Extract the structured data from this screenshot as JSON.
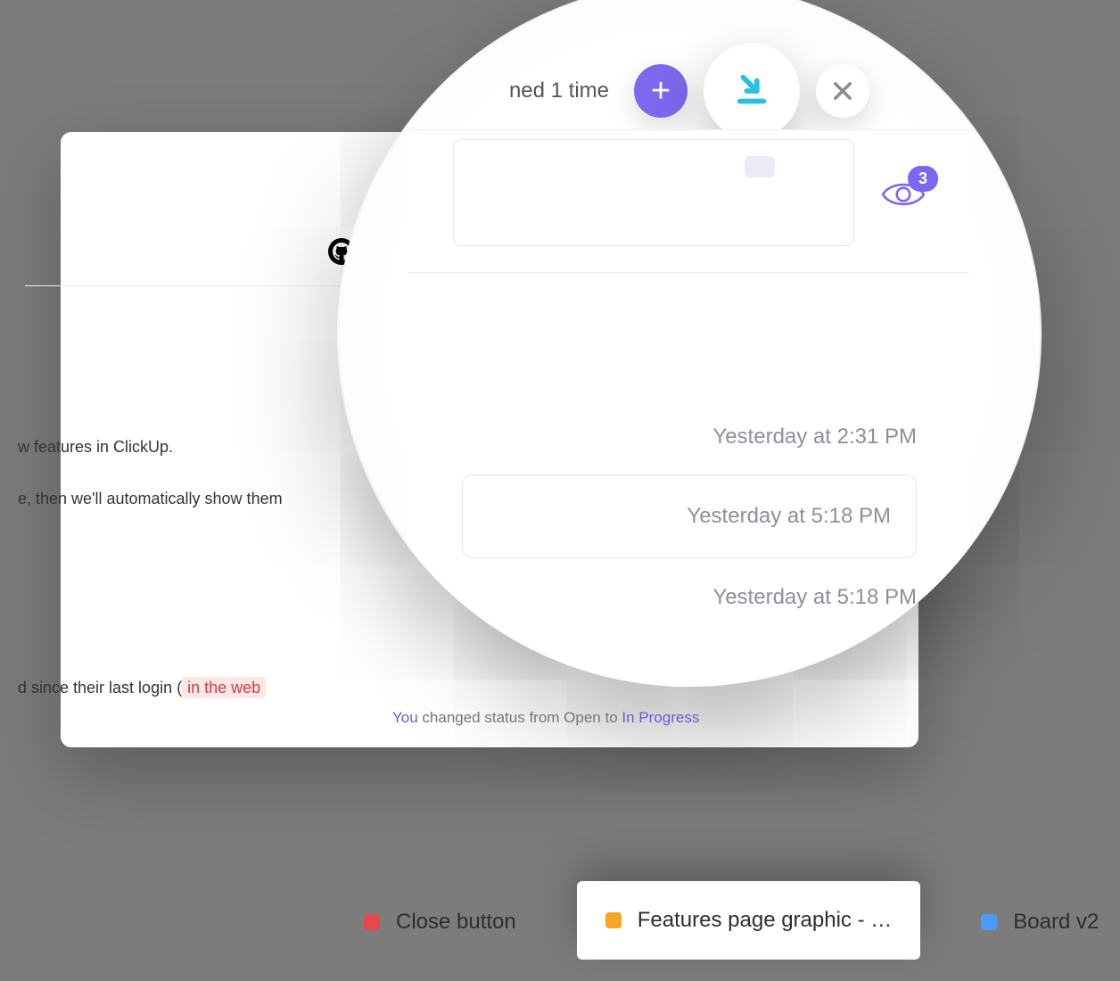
{
  "header": {
    "mentioned_text": "ned 1 time"
  },
  "actions": {
    "add_label": "+",
    "minimize_icon": "minimize-to-tray-icon",
    "close_icon": "close-icon"
  },
  "watchers": {
    "count": "3"
  },
  "description": {
    "line1": "w features in ClickUp.",
    "line2": "e, then we'll automatically show them",
    "line3_pre": "d since their last login (",
    "line3_link": "in the   web"
  },
  "activity": {
    "ts1": "Yesterday at 2:31 PM",
    "ts2": "Yesterday at 5:18 PM",
    "ts3": "Yesterday at 5:18 PM",
    "status_you": "You",
    "status_mid": " changed status from ",
    "status_from": "Open",
    "status_to_word": " to ",
    "status_to": "In Progress"
  },
  "tray": [
    {
      "label": "Close button",
      "color": "red"
    },
    {
      "label": "Features page graphic - …",
      "color": "orange",
      "active": true
    },
    {
      "label": "Board v2",
      "color": "blue"
    }
  ]
}
